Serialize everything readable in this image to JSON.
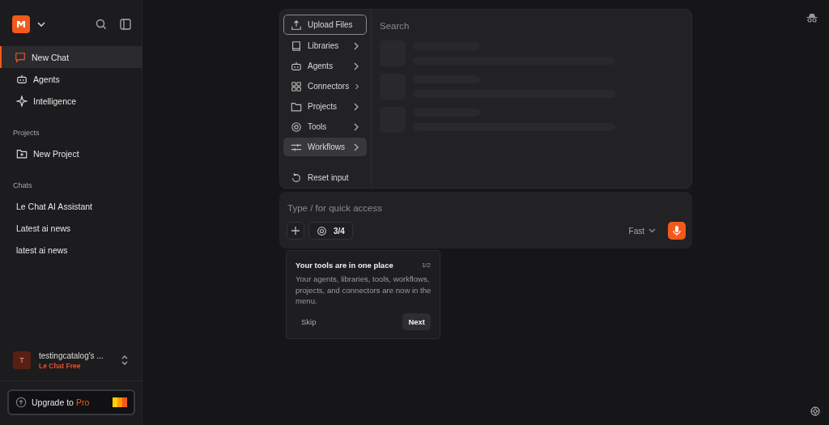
{
  "sidebar": {
    "nav": [
      {
        "label": "New Chat",
        "selected": true
      },
      {
        "label": "Agents",
        "selected": false
      },
      {
        "label": "Intelligence",
        "selected": false
      }
    ],
    "sections": [
      {
        "title": "Projects",
        "items": [
          {
            "label": "New Project"
          }
        ]
      },
      {
        "title": "Chats",
        "items": [
          {
            "label": "Le Chat AI Assistant"
          },
          {
            "label": "Latest ai news"
          },
          {
            "label": "latest ai news"
          }
        ]
      }
    ],
    "account": {
      "initial": "T",
      "name": "testingcatalog's ...",
      "plan": "Le Chat Free"
    },
    "upgrade": {
      "text": "Upgrade to ",
      "highlight": "Pro"
    }
  },
  "menu": {
    "items": [
      {
        "label": "Upload Files",
        "submenu": false,
        "focused": true,
        "selected": false
      },
      {
        "label": "Libraries",
        "submenu": true,
        "focused": false,
        "selected": false
      },
      {
        "label": "Agents",
        "submenu": true,
        "focused": false,
        "selected": false
      },
      {
        "label": "Connectors",
        "submenu": true,
        "focused": false,
        "selected": false
      },
      {
        "label": "Projects",
        "submenu": true,
        "focused": false,
        "selected": false
      },
      {
        "label": "Tools",
        "submenu": true,
        "focused": false,
        "selected": false
      },
      {
        "label": "Workflows",
        "submenu": true,
        "focused": false,
        "selected": true
      }
    ],
    "reset": "Reset input",
    "search": {
      "placeholder": "Search",
      "loading": true
    }
  },
  "composer": {
    "placeholder": "Type / for quick access",
    "tools_count": "3/4",
    "mode": "Fast"
  },
  "tour": {
    "title": "Your tools are in one place",
    "step": "1/2",
    "body": "Your agents, libraries, tools, workflows, projects, and connectors are now in the menu.",
    "skip": "Skip",
    "next": "Next"
  }
}
